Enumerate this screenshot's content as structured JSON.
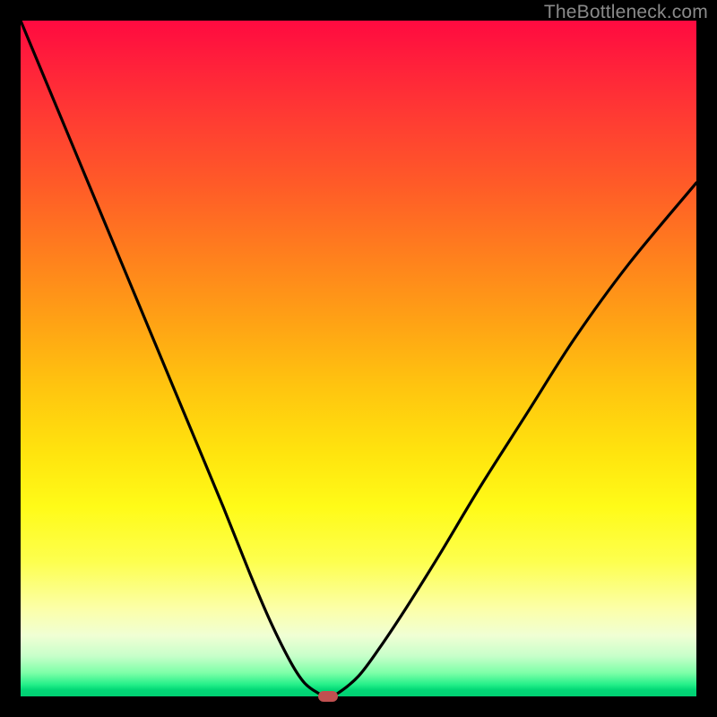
{
  "watermark": "TheBottleneck.com",
  "colors": {
    "frame": "#000000",
    "curve": "#000000",
    "marker": "#c05050"
  },
  "chart_data": {
    "type": "line",
    "title": "",
    "xlabel": "",
    "ylabel": "",
    "xlim": [
      0,
      100
    ],
    "ylim": [
      0,
      100
    ],
    "series": [
      {
        "name": "curve",
        "x": [
          0,
          5,
          10,
          15,
          20,
          25,
          30,
          34,
          37,
          40,
          42,
          44,
          45.5,
          47,
          50,
          53,
          57,
          62,
          68,
          75,
          82,
          90,
          100
        ],
        "y": [
          100,
          88,
          76,
          64,
          52,
          40,
          28,
          18,
          11,
          5,
          2,
          0.5,
          0,
          0.5,
          3,
          7,
          13,
          21,
          31,
          42,
          53,
          64,
          76
        ]
      }
    ],
    "marker": {
      "x": 45.5,
      "y": 0
    }
  }
}
